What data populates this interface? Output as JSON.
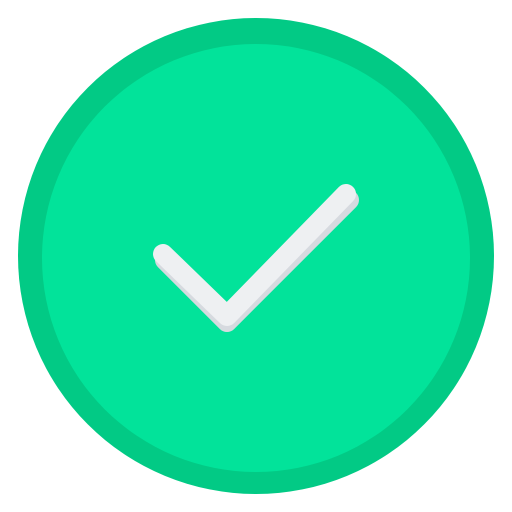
{
  "icon": {
    "name": "check-circle-icon",
    "colors": {
      "background": "#ffffff",
      "outer_ring": "#02CA85",
      "inner_disc": "#02E39A",
      "check_shadow": "#D6DADF",
      "check_mark": "#EEF0F2"
    }
  }
}
